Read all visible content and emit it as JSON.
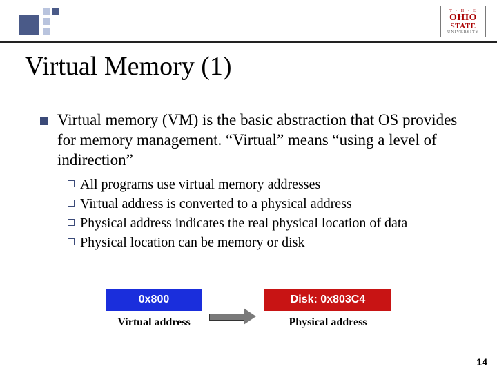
{
  "logo": {
    "line1": "T · H · E",
    "line2": "OHIO",
    "line3": "STATE",
    "line4": "UNIVERSITY"
  },
  "title": "Virtual Memory (1)",
  "bullets": [
    "Virtual memory (VM) is the basic abstraction that OS provides for memory management. “Virtual” means “using a level of indirection”"
  ],
  "subbullets": [
    "All programs use virtual memory addresses",
    "Virtual address is converted to a physical address",
    "Physical address indicates the real physical location of data",
    "Physical location can be memory or disk"
  ],
  "diagram": {
    "left_box": "0x800",
    "right_box": "Disk: 0x803C4",
    "left_caption": "Virtual address",
    "right_caption": "Physical address"
  },
  "page_number": "14"
}
